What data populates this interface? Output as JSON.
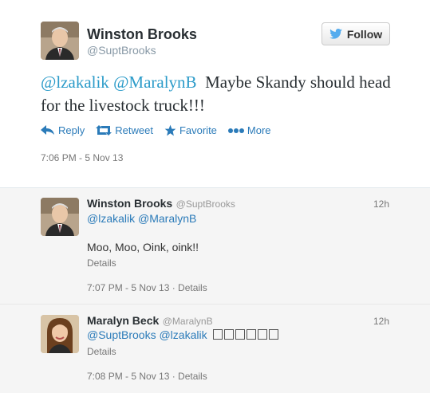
{
  "tweet": {
    "author_name": "Winston Brooks",
    "author_handle": "@SuptBrooks",
    "follow_label": "Follow",
    "mention1": "@lzakalik",
    "mention2": "@MaralynB",
    "text": "Maybe Skandy should head for the livestock truck!!!",
    "actions": {
      "reply": "Reply",
      "retweet": "Retweet",
      "favorite": "Favorite",
      "more": "More"
    },
    "timestamp": "7:06 PM - 5 Nov 13"
  },
  "replies": [
    {
      "name": "Winston Brooks",
      "handle": "@SuptBrooks",
      "age": "12h",
      "mentions": "@lzakalik @MaralynB",
      "text": "Moo, Moo, Oink, oink!!",
      "details": "Details",
      "footer": "7:07 PM - 5 Nov 13 · Details"
    },
    {
      "name": "Maralyn Beck",
      "handle": "@MaralynB",
      "age": "12h",
      "mentions": "@SuptBrooks @lzakalik",
      "details": "Details",
      "footer": "7:08 PM - 5 Nov 13 · Details"
    }
  ],
  "colors": {
    "link": "#2b7bb9",
    "accent": "#2b9bc9",
    "reply_bg": "#f5f5f5"
  }
}
